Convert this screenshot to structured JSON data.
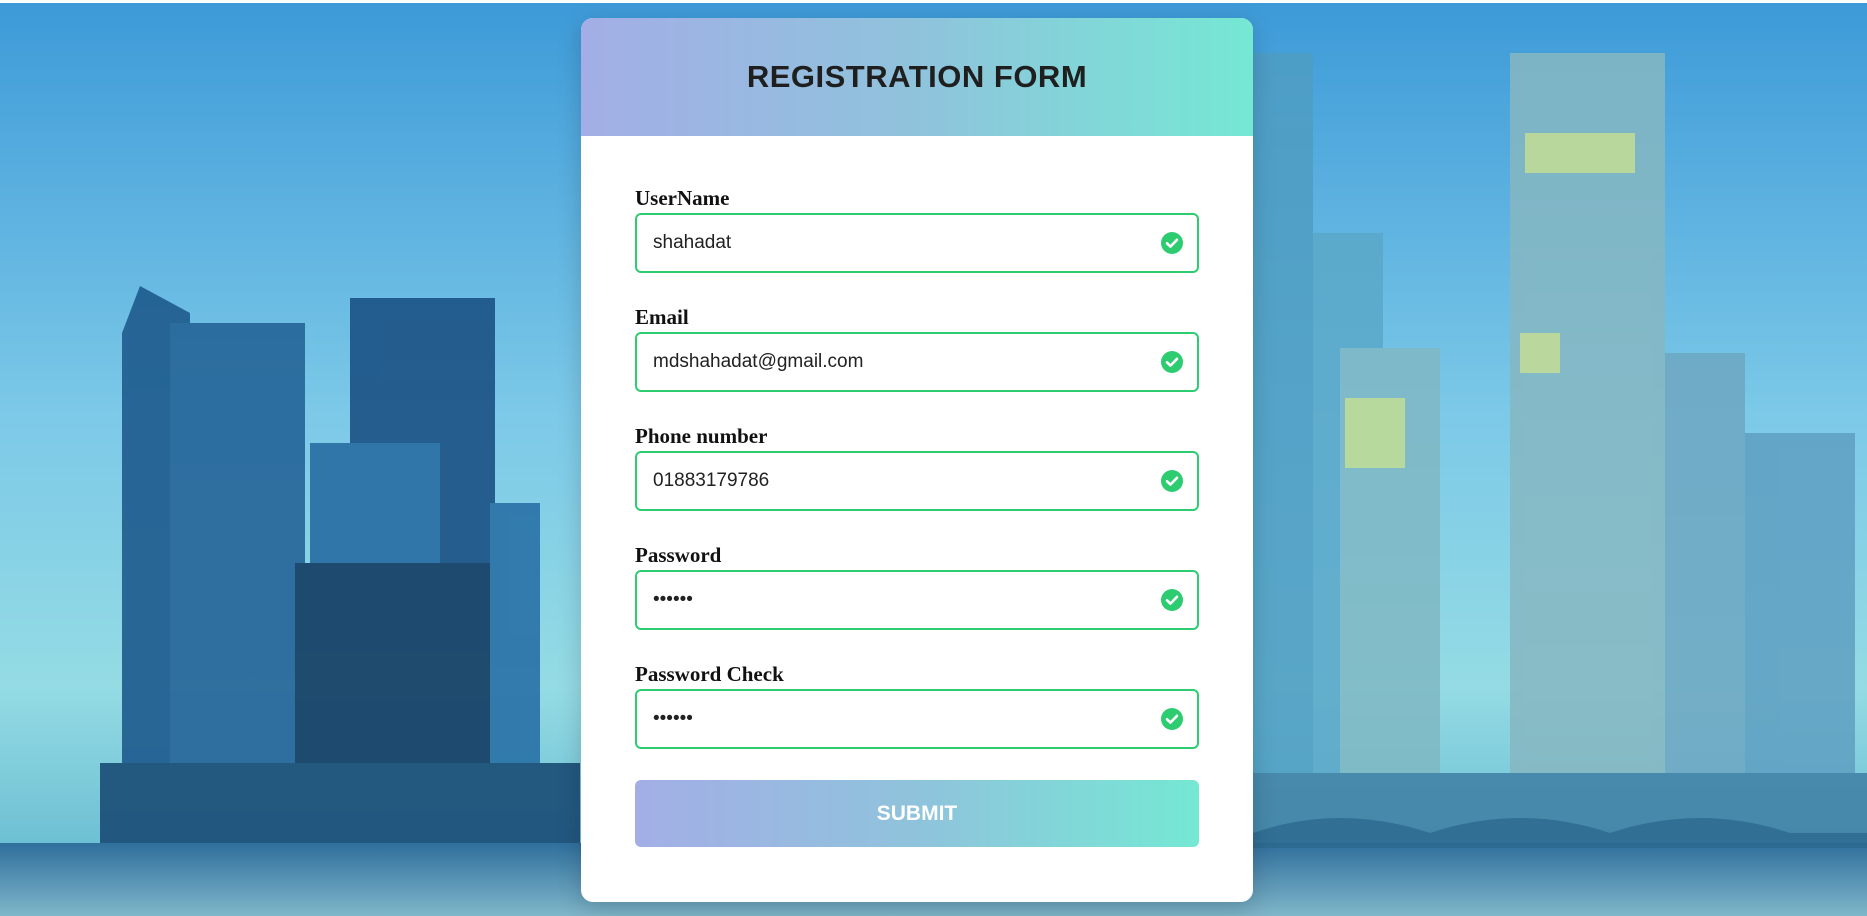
{
  "form": {
    "title": "REGISTRATION FORM",
    "fields": [
      {
        "label": "UserName",
        "value": "shahadat",
        "type": "text",
        "status": "valid"
      },
      {
        "label": "Email",
        "value": "mdshahadat@gmail.com",
        "type": "text",
        "status": "valid"
      },
      {
        "label": "Phone number",
        "value": "01883179786",
        "type": "text",
        "status": "valid"
      },
      {
        "label": "Password",
        "value": "shahad",
        "type": "password",
        "status": "valid"
      },
      {
        "label": "Password Check",
        "value": "shahad",
        "type": "password",
        "status": "valid"
      }
    ],
    "submit_label": "SUBMIT"
  },
  "colors": {
    "gradient_start": "#a3aee6",
    "gradient_end": "#75e8d4",
    "valid": "#2ecc71",
    "card_background": "#ffffff"
  },
  "icons": {
    "valid": "check-circle-icon"
  }
}
